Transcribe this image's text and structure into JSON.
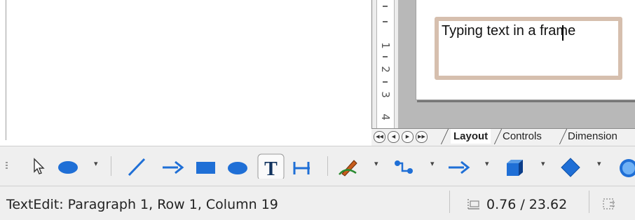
{
  "document": {
    "frame_text": "Typing text in a frame"
  },
  "ruler": {
    "numbers": [
      "1",
      "2",
      "3",
      "4"
    ]
  },
  "tabs": {
    "items": [
      {
        "label": "Layout",
        "active": true
      },
      {
        "label": "Controls",
        "active": false
      },
      {
        "label": "Dimension",
        "active": false
      }
    ]
  },
  "toolbar": {
    "tools": [
      "select-icon",
      "ellipse-icon",
      "line-icon",
      "arrow-line-icon",
      "rectangle-icon",
      "ellipse-shape-icon",
      "text-icon",
      "text-fit-icon",
      "curve-icon",
      "connector-icon",
      "arrow-icon",
      "cube-icon",
      "diamond-icon",
      "smiley-icon"
    ],
    "colors": {
      "accent_blue": "#1f6fd6",
      "frame_border": "#d6bfae"
    }
  },
  "statusbar": {
    "status_text": "TextEdit: Paragraph 1, Row 1, Column 19",
    "position_text": "0.76 / 23.62"
  }
}
